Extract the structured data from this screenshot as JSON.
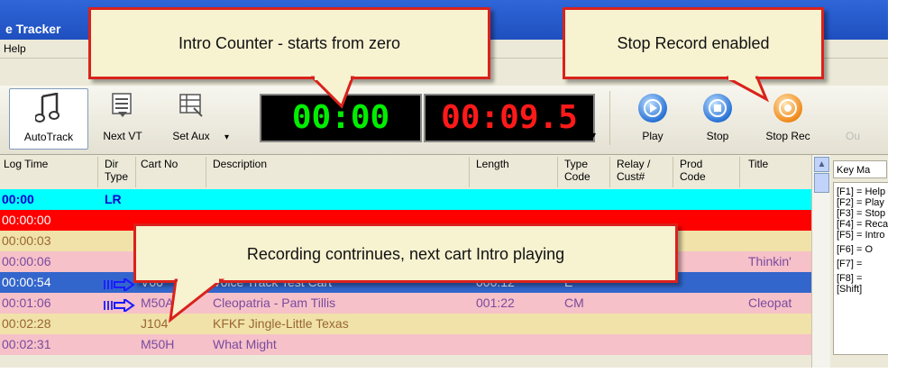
{
  "window": {
    "title": "e Tracker",
    "menu": "Help"
  },
  "toolbar": {
    "autotrack": "AutoTrack",
    "next_vt": "Next VT",
    "set_aux": "Set Aux",
    "green_counter": "00:00",
    "red_counter": "00:09.5",
    "play": "Play",
    "stop": "Stop",
    "stop_rec": "Stop Rec",
    "extra": "Ou"
  },
  "columns": {
    "log_time": "Log Time",
    "dir_type": [
      "Dir",
      "Type"
    ],
    "cart_no": "Cart No",
    "description": "Description",
    "length": "Length",
    "type_code": [
      "Type",
      "Code"
    ],
    "relay": [
      "Relay /",
      "Cust#"
    ],
    "prod_code": [
      "Prod",
      "Code"
    ],
    "title": "Title"
  },
  "rows": [
    {
      "time": "00:00",
      "dir": "LR",
      "cart": "",
      "desc": "",
      "length": "",
      "type": "",
      "title": "",
      "bg": "#00ffff",
      "fg": "#0000cc"
    },
    {
      "time": "00:00:00",
      "dir": "",
      "cart": "",
      "desc": "",
      "length": "",
      "type": "",
      "title": "",
      "bg": "#ff0000",
      "fg": "#ffffff"
    },
    {
      "time": "00:00:03",
      "dir": "",
      "cart": "",
      "desc": "",
      "length": "",
      "type": "",
      "title": "",
      "bg": "#f0e2a8",
      "fg": "#996633"
    },
    {
      "time": "00:00:06",
      "dir": "",
      "cart": "",
      "desc": "",
      "length": "",
      "type": "",
      "title": "Thinkin'",
      "bg": "#f6c1c8",
      "fg": "#7a4aa0"
    },
    {
      "time": "00:00:54",
      "dir": "",
      "cart": "V00",
      "desc": "Voice Track Test Cart",
      "length": "000:12",
      "type": "E",
      "title": "",
      "bg": "#3366cc",
      "fg": "#ffffff"
    },
    {
      "time": "00:01:06",
      "dir": "",
      "cart": "M50A",
      "desc": "Cleopatria - Pam Tillis",
      "length": "001:22",
      "type": "CM",
      "title": "Cleopat",
      "bg": "#f6c1c8",
      "fg": "#7a4aa0"
    },
    {
      "time": "00:02:28",
      "dir": "",
      "cart": "J104",
      "desc": "KFKF Jingle-Little Texas",
      "length": "",
      "type": "",
      "title": "",
      "bg": "#f0e2a8",
      "fg": "#996633"
    },
    {
      "time": "00:02:31",
      "dir": "",
      "cart": "M50H",
      "desc": "What Might",
      "length": "",
      "type": "",
      "title": "",
      "bg": "#f6c1c8",
      "fg": "#7a4aa0"
    }
  ],
  "key_panel": {
    "title": "Key Ma",
    "keys": [
      "[F1] = Help",
      "[F2] = Play",
      "[F3] = Stop",
      "[F4] = Reca",
      "[F5] = Intro",
      "[F6] = O",
      "[F7] =",
      "[F8] =",
      "[Shift]"
    ]
  },
  "callouts": {
    "intro": "Intro Counter - starts from zero",
    "stoprec": "Stop Record enabled",
    "recording": "Recording contrinues, next cart Intro playing"
  },
  "colors": {
    "green_counter": "#00ee00",
    "red_counter": "#ff1a1a",
    "callout_border": "#d9221c",
    "callout_fill": "#f7f2d0"
  }
}
